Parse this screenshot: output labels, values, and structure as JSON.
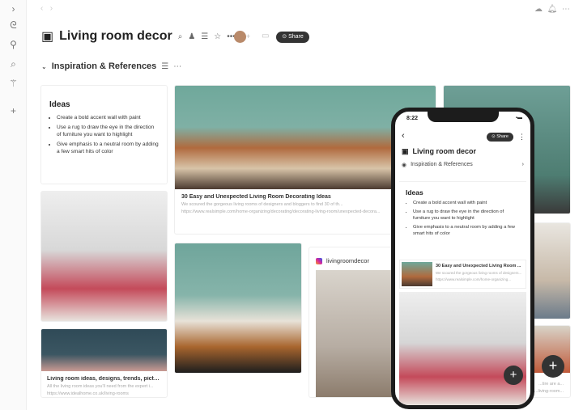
{
  "page": {
    "title": "Living room decor",
    "share": "Share",
    "nav_back": "‹",
    "nav_fwd": "›"
  },
  "section": {
    "title": "Inspiration & References"
  },
  "ideas": {
    "title": "Ideas",
    "items": [
      "Create a bold accent wall with paint",
      "Use a rug to draw the eye in the direction of furniture you want to highlight",
      "Give emphasis to a neutral room by adding a few smart hits of color"
    ]
  },
  "cards": [
    {
      "title": "30 Easy and Unexpected Living Room Decorating Ideas",
      "desc": "We scoured the gorgeous living rooms of designers and bloggers to find 30 of th...",
      "url": "https://www.realsimple.com/home-organizing/decorating/decorating-living-room/unexpected-decora..."
    },
    {
      "title": "Living room ideas, designs, trends, picture...",
      "desc": "All the living room ideas you'll need from the expert i...",
      "url": "https://www.idealhome.co.uk/living-rooms"
    },
    {
      "source": "livingroomdecor"
    },
    {
      "desc": "...tire are a...",
      "url": "...living-room..."
    }
  ],
  "phone": {
    "time": "8:22",
    "share": "Share",
    "title": "Living room decor",
    "section": "Inspiration & References",
    "card_title": "30 Easy and Unexpected Living Room ...",
    "card_desc": "We scoured the gorgeous living rooms of designers...",
    "card_url": "https://www.realsimple.com/home-organizing..."
  },
  "fab": "+"
}
